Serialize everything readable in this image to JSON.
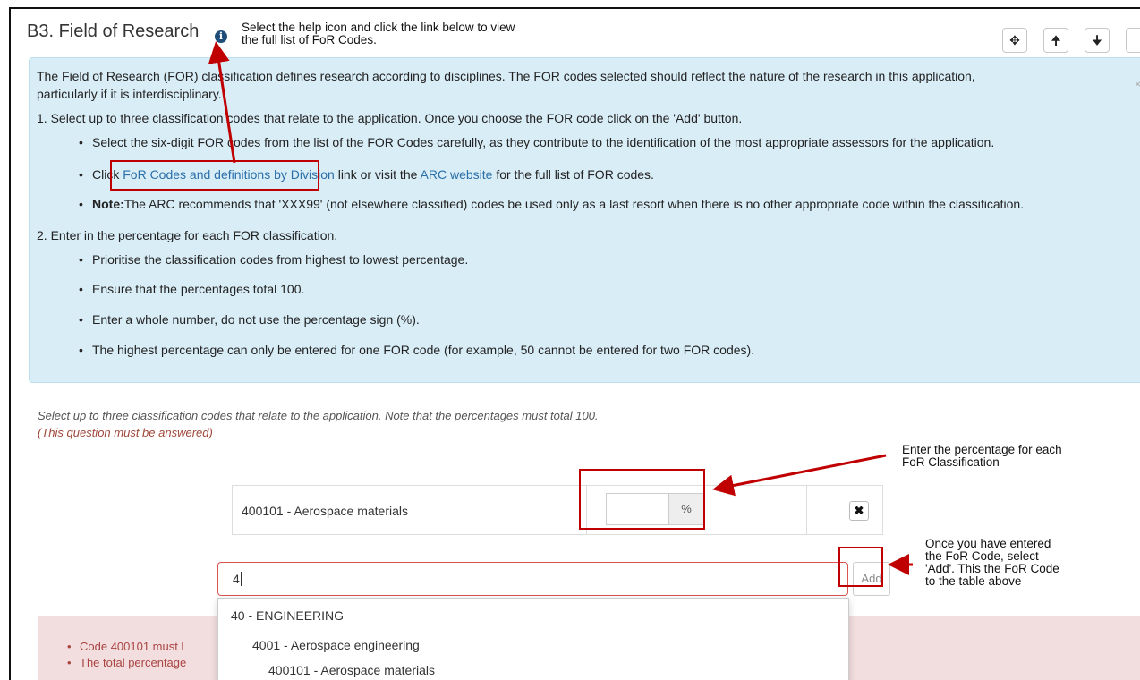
{
  "section": {
    "title": "B3. Field of Research"
  },
  "annotations": {
    "help_tip_line1": "Select the help icon and click the link below to view",
    "help_tip_line2": "the full list of FoR Codes.",
    "percent_tip_line1": "Enter the percentage for each",
    "percent_tip_line2": "FoR Classification",
    "add_tip_line1": "Once you have entered",
    "add_tip_line2": "the FoR Code, select",
    "add_tip_line3": "'Add'. This the FoR Code",
    "add_tip_line4": "to the table above"
  },
  "toolbar": {
    "move_icon": "move-icon",
    "up_icon": "arrow-up-icon",
    "down_icon": "arrow-down-icon"
  },
  "info": {
    "intro_line1": "The Field of Research (FOR) classification defines research according to disciplines. The FOR codes selected should reflect the nature of the research in this application,",
    "intro_line2": "particularly if it is interdisciplinary.",
    "step1": "1. Select up to three classification codes that relate to the application. Once you choose the FOR code click on the 'Add' button.",
    "step1_bullet1": "Select the six-digit FOR codes from the list of the FOR Codes carefully, as they contribute to the identification of the most appropriate assessors for the application.",
    "step1_bullet2_pre": "Click ",
    "step1_bullet2_link1": "FoR Codes and definitions by Division",
    "step1_bullet2_mid": " link or visit the ",
    "step1_bullet2_link2": "ARC website",
    "step1_bullet2_post": " for the full list of FOR codes.",
    "step1_bullet3_bold": "Note:",
    "step1_bullet3_text": "The ARC recommends that 'XXX99' (not elsewhere classified) codes be used only as a last resort when there is no other appropriate code within the classification.",
    "step2": "2. Enter in the percentage for each FOR classification.",
    "step2_bullet1": "Prioritise the classification codes from highest to lowest percentage.",
    "step2_bullet2": "Ensure that the percentages total 100.",
    "step2_bullet3": "Enter a whole number, do not use the percentage sign (%).",
    "step2_bullet4": "The highest percentage can only be entered for one FOR code (for example, 50 cannot be entered for two FOR codes)."
  },
  "question": {
    "prompt": "Select up to three classification codes that relate to the application. Note that the percentages must total 100.",
    "required": "(This question must be answered)"
  },
  "table": {
    "rows": [
      {
        "code": "400101 - Aerospace materials",
        "percentage": "",
        "unit": "%"
      }
    ]
  },
  "search": {
    "value": "4",
    "add_label": "Add"
  },
  "errors": [
    "Code 400101 must l",
    "The total percentage"
  ],
  "dropdown": {
    "items": [
      {
        "label": "40 - ENGINEERING",
        "level": 0
      },
      {
        "label": "4001 - Aerospace engineering",
        "level": 1
      },
      {
        "label": "400101 - Aerospace materials",
        "level": 2
      }
    ]
  },
  "colors": {
    "annotation_red": "#c00000",
    "info_bg": "#d9edf7",
    "error_bg": "#f2dede",
    "link": "#2a6fa8"
  }
}
